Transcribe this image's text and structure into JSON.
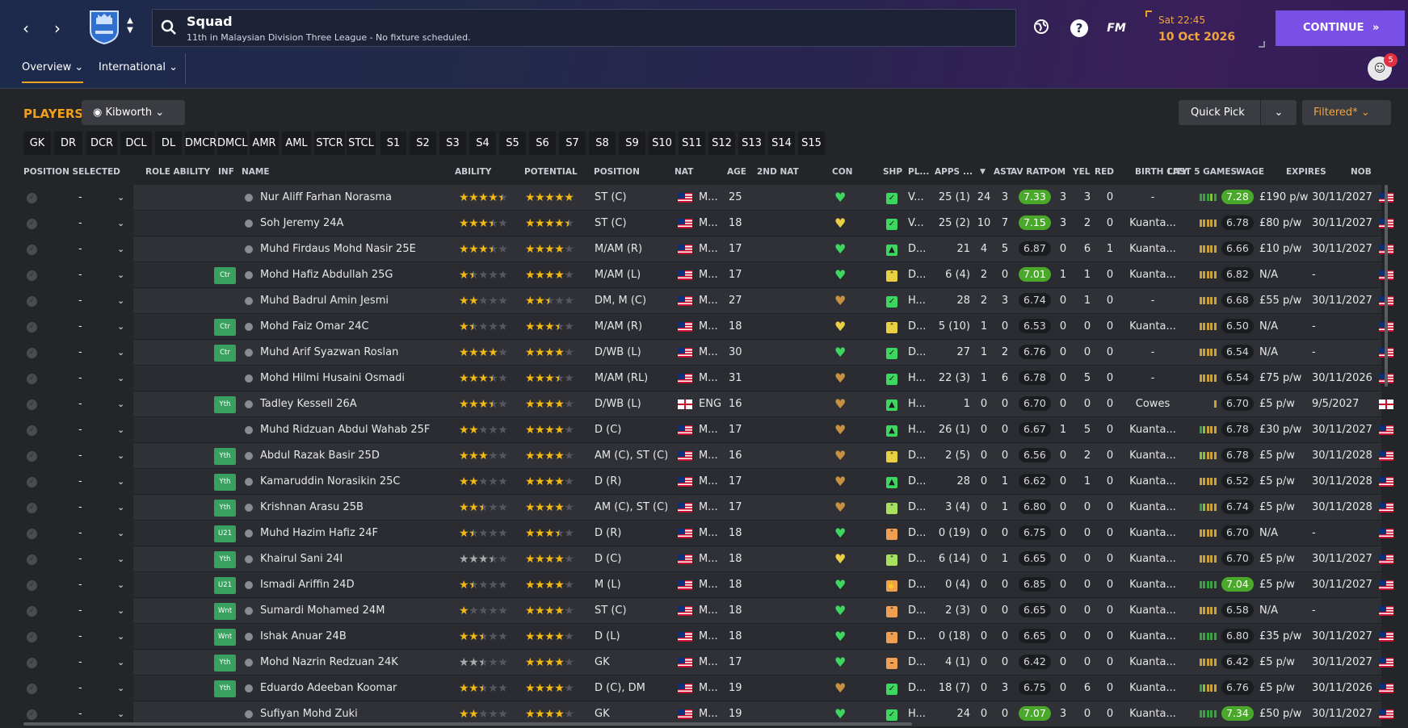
{
  "header": {
    "title": "Squad",
    "subtitle": "11th in Malaysian Division Three League - No fixture scheduled.",
    "date_time": "Sat 22:45",
    "date": "10 Oct 2026",
    "continue_label": "CONTINUE",
    "tabs": [
      "Overview",
      "International"
    ],
    "notifications": "5",
    "fm_label": "FM"
  },
  "toolbar": {
    "players_label": "PLAYERS",
    "view_label": "Kibworth",
    "quick_pick": "Quick Pick",
    "filtered": "Filtered*"
  },
  "positions": [
    "GK",
    "DR",
    "DCR",
    "DCL",
    "DL",
    "DMCR",
    "DMCL",
    "AMR",
    "AML",
    "STCR",
    "STCL",
    "S1",
    "S2",
    "S3",
    "S4",
    "S5",
    "S6",
    "S7",
    "S8",
    "S9",
    "S10",
    "S11",
    "S12",
    "S13",
    "S14",
    "S15"
  ],
  "columns": [
    "POSITION SELECTED",
    "ROLE ABILITY",
    "INF",
    "NAME",
    "ABILITY",
    "POTENTIAL",
    "POSITION",
    "NAT",
    "AGE",
    "2ND NAT",
    "CON",
    "SHP",
    "PL...",
    "APPS",
    "...",
    "AST",
    "AV RAT",
    "POM",
    "YEL",
    "RED",
    "BIRTH CITY",
    "LAST 5 GAMES",
    "WAGE",
    "EXPIRES",
    "NOB"
  ],
  "colors": {
    "accent": "#f0a020",
    "continue": "#7a4fe6",
    "rating_high": "#4aa82a",
    "star": "#f0b818"
  },
  "rows": [
    {
      "sel": "-",
      "inf": "",
      "name": "Nur Aliff Farhan Norasma",
      "ab": 4.5,
      "abc": "y",
      "pot": 5,
      "pos": "ST (C)",
      "nat": "M...",
      "flag": "my",
      "age": "25",
      "con": "green",
      "shp": "tick",
      "shpc": "#3dd65e",
      "pl": "V...",
      "apps": "25 (1)",
      "gls": "24",
      "ast": "3",
      "avr": "7.33",
      "avh": true,
      "pom": "3",
      "yel": "3",
      "red": "0",
      "city": "-",
      "last5": [
        "#3aa040",
        "#3aa040",
        "#3aa040",
        "#8ac040",
        "#3aa040"
      ],
      "l5r": "7.28",
      "l5h": true,
      "wage": "£190 p/w",
      "exp": "30/11/2027"
    },
    {
      "sel": "-",
      "inf": "",
      "name": "Soh Jeremy 24A",
      "ab": 3.5,
      "abc": "y",
      "pot": 4.5,
      "pos": "ST (C)",
      "nat": "M...",
      "flag": "my",
      "age": "18",
      "con": "yellow",
      "shp": "tick",
      "shpc": "#3dd65e",
      "pl": "V...",
      "apps": "25 (2)",
      "gls": "10",
      "ast": "7",
      "avr": "7.15",
      "avh": true,
      "pom": "3",
      "yel": "2",
      "red": "0",
      "city": "Kuanta...",
      "last5": [
        "#c8a040",
        "#c8a040",
        "#c8a040",
        "#c8a040",
        "#c8a040"
      ],
      "l5r": "6.78",
      "l5h": false,
      "wage": "£80 p/w",
      "exp": "30/11/2027"
    },
    {
      "sel": "-",
      "inf": "",
      "name": "Muhd Firdaus Mohd Nasir 25E",
      "ab": 3.5,
      "abc": "y",
      "pot": 4,
      "pos": "M/AM (R)",
      "nat": "M...",
      "flag": "my",
      "age": "17",
      "con": "green",
      "shp": "thumb",
      "shpc": "#3dd65e",
      "pl": "D...",
      "apps": "21",
      "gls": "4",
      "ast": "5",
      "avr": "6.87",
      "avh": false,
      "pom": "0",
      "yel": "6",
      "red": "1",
      "city": "Kuanta...",
      "last5": [
        "#c8a040",
        "#c8a040",
        "#c8a040",
        "#c8a040",
        "#c8a040"
      ],
      "l5r": "6.66",
      "l5h": false,
      "wage": "£10 p/w",
      "exp": "30/11/2027"
    },
    {
      "sel": "-",
      "inf": "Ctr",
      "name": "Mohd Hafiz Abdullah 25G",
      "ab": 1.5,
      "abc": "y",
      "pot": 4,
      "pos": "M/AM (L)",
      "nat": "M...",
      "flag": "my",
      "age": "17",
      "con": "green",
      "shp": "up",
      "shpc": "#e8d040",
      "pl": "D...",
      "apps": "6 (4)",
      "gls": "2",
      "ast": "0",
      "avr": "7.01",
      "avh": true,
      "pom": "1",
      "yel": "1",
      "red": "0",
      "city": "Kuanta...",
      "last5": [
        "#c8a040",
        "#c8a040",
        "#c8a040",
        "#c8a040",
        "#c8a040"
      ],
      "l5r": "6.82",
      "l5h": false,
      "wage": "N/A",
      "exp": "-"
    },
    {
      "sel": "-",
      "inf": "",
      "name": "Muhd Badrul Amin Jesmi",
      "ab": 2,
      "abc": "y",
      "pot": 2.5,
      "pos": "DM, M (C)",
      "nat": "M...",
      "flag": "my",
      "age": "27",
      "con": "brown",
      "shp": "tick",
      "shpc": "#3dd65e",
      "pl": "H...",
      "apps": "28",
      "gls": "2",
      "ast": "3",
      "avr": "6.74",
      "avh": false,
      "pom": "0",
      "yel": "1",
      "red": "0",
      "city": "-",
      "last5": [
        "#c8a040",
        "#c8a040",
        "#c8a040",
        "#c8a040",
        "#c8a040"
      ],
      "l5r": "6.68",
      "l5h": false,
      "wage": "£55 p/w",
      "exp": "30/11/2027"
    },
    {
      "sel": "-",
      "inf": "Ctr",
      "name": "Mohd Faiz Omar 24C",
      "ab": 1.5,
      "abc": "y",
      "pot": 3.5,
      "pos": "M/AM (R)",
      "nat": "M...",
      "flag": "my",
      "age": "18",
      "con": "yellow",
      "shp": "up",
      "shpc": "#e8d040",
      "pl": "D...",
      "apps": "5 (10)",
      "gls": "1",
      "ast": "0",
      "avr": "6.53",
      "avh": false,
      "pom": "0",
      "yel": "0",
      "red": "0",
      "city": "Kuanta...",
      "last5": [
        "#c8a040",
        "#c8a040",
        "#c8a040",
        "#c8a040",
        "#c8a040"
      ],
      "l5r": "6.50",
      "l5h": false,
      "wage": "N/A",
      "exp": "-"
    },
    {
      "sel": "-",
      "inf": "Ctr",
      "name": "Muhd Arif Syazwan Roslan",
      "ab": 4,
      "abc": "y",
      "pot": 4,
      "pos": "D/WB (L)",
      "nat": "M...",
      "flag": "my",
      "age": "30",
      "con": "green",
      "shp": "tick",
      "shpc": "#3dd65e",
      "pl": "D...",
      "apps": "27",
      "gls": "1",
      "ast": "2",
      "avr": "6.76",
      "avh": false,
      "pom": "0",
      "yel": "0",
      "red": "0",
      "city": "-",
      "last5": [
        "#c8a040",
        "#c8a040",
        "#c8a040",
        "#c8a040",
        "#c8a040"
      ],
      "l5r": "6.54",
      "l5h": false,
      "wage": "N/A",
      "exp": "-"
    },
    {
      "sel": "-",
      "inf": "",
      "name": "Mohd Hilmi Husaini Osmadi",
      "ab": 3.5,
      "abc": "y",
      "pot": 3.5,
      "pos": "M/AM (RL)",
      "nat": "M...",
      "flag": "my",
      "age": "31",
      "con": "brown",
      "shp": "tick",
      "shpc": "#3dd65e",
      "pl": "H...",
      "apps": "22 (3)",
      "gls": "1",
      "ast": "6",
      "avr": "6.78",
      "avh": false,
      "pom": "0",
      "yel": "5",
      "red": "0",
      "city": "-",
      "last5": [
        "#c8a040",
        "#c8a040",
        "#c8a040",
        "#c8a040",
        "#c8a040"
      ],
      "l5r": "6.54",
      "l5h": false,
      "wage": "£75 p/w",
      "exp": "30/11/2026"
    },
    {
      "sel": "-",
      "inf": "Yth",
      "name": "Tadley Kessell 26A",
      "ab": 3.5,
      "abc": "y",
      "pot": 4,
      "pos": "D/WB (L)",
      "nat": "ENG",
      "flag": "en",
      "age": "16",
      "con": "brown",
      "shp": "thumb",
      "shpc": "#3dd65e",
      "pl": "H...",
      "apps": "1",
      "gls": "0",
      "ast": "0",
      "avr": "6.70",
      "avh": false,
      "pom": "0",
      "yel": "0",
      "red": "0",
      "city": "Cowes",
      "last5": [
        "#c8a040"
      ],
      "l5r": "6.70",
      "l5h": false,
      "wage": "£5 p/w",
      "exp": "9/5/2027"
    },
    {
      "sel": "-",
      "inf": "",
      "name": "Muhd Ridzuan Abdul Wahab 25F",
      "ab": 2,
      "abc": "y",
      "pot": 4,
      "pos": "D (C)",
      "nat": "M...",
      "flag": "my",
      "age": "17",
      "con": "brown",
      "shp": "thumb",
      "shpc": "#3dd65e",
      "pl": "H...",
      "apps": "26 (1)",
      "gls": "0",
      "ast": "0",
      "avr": "6.67",
      "avh": false,
      "pom": "1",
      "yel": "5",
      "red": "0",
      "city": "Kuanta...",
      "last5": [
        "#3aa040",
        "#8ac040",
        "#c8a040",
        "#c8a040",
        "#c8a040"
      ],
      "l5r": "6.78",
      "l5h": false,
      "wage": "£30 p/w",
      "exp": "30/11/2027"
    },
    {
      "sel": "-",
      "inf": "Yth",
      "name": "Abdul Razak Basir 25D",
      "ab": 3,
      "abc": "y",
      "pot": 4,
      "pos": "AM (C), ST (C)",
      "nat": "M...",
      "flag": "my",
      "age": "16",
      "con": "brown",
      "shp": "up",
      "shpc": "#e8d040",
      "pl": "D...",
      "apps": "2 (5)",
      "gls": "0",
      "ast": "0",
      "avr": "6.56",
      "avh": false,
      "pom": "0",
      "yel": "2",
      "red": "0",
      "city": "Kuanta...",
      "last5": [
        "#8ac040",
        "#8ac040",
        "#c8a040",
        "#c8a040",
        "#c8a040"
      ],
      "l5r": "6.78",
      "l5h": false,
      "wage": "£5 p/w",
      "exp": "30/11/2028"
    },
    {
      "sel": "-",
      "inf": "Yth",
      "name": "Kamaruddin Norasikin 25C",
      "ab": 2,
      "abc": "y",
      "pot": 4,
      "pos": "D (R)",
      "nat": "M...",
      "flag": "my",
      "age": "17",
      "con": "brown",
      "shp": "thumb",
      "shpc": "#3dd65e",
      "pl": "D...",
      "apps": "28",
      "gls": "0",
      "ast": "1",
      "avr": "6.62",
      "avh": false,
      "pom": "0",
      "yel": "1",
      "red": "0",
      "city": "Kuanta...",
      "last5": [
        "#c8a040",
        "#c8a040",
        "#c8a040",
        "#c8a040",
        "#c8a040"
      ],
      "l5r": "6.52",
      "l5h": false,
      "wage": "£5 p/w",
      "exp": "30/11/2028"
    },
    {
      "sel": "-",
      "inf": "Yth",
      "name": "Krishnan Arasu 25B",
      "ab": 2.5,
      "abc": "y",
      "pot": 4,
      "pos": "AM (C), ST (C)",
      "nat": "M...",
      "flag": "my",
      "age": "17",
      "con": "brown",
      "shp": "up",
      "shpc": "#a8e060",
      "pl": "D...",
      "apps": "3 (4)",
      "gls": "0",
      "ast": "1",
      "avr": "6.80",
      "avh": false,
      "pom": "0",
      "yel": "0",
      "red": "0",
      "city": "Kuanta...",
      "last5": [
        "#3aa040",
        "#8ac040",
        "#c8a040",
        "#c8a040",
        "#c8a040"
      ],
      "l5r": "6.74",
      "l5h": false,
      "wage": "£5 p/w",
      "exp": "30/11/2028"
    },
    {
      "sel": "-",
      "inf": "U21",
      "name": "Muhd Hazim Hafiz 24F",
      "ab": 1.5,
      "abc": "y",
      "pot": 3.5,
      "pos": "D (R)",
      "nat": "M...",
      "flag": "my",
      "age": "18",
      "con": "green",
      "shp": "up",
      "shpc": "#f0a050",
      "pl": "D...",
      "apps": "0 (19)",
      "gls": "0",
      "ast": "0",
      "avr": "6.75",
      "avh": false,
      "pom": "0",
      "yel": "0",
      "red": "0",
      "city": "Kuanta...",
      "last5": [
        "#c8a040",
        "#c8a040",
        "#c8a040",
        "#c8a040",
        "#c8a040"
      ],
      "l5r": "6.70",
      "l5h": false,
      "wage": "N/A",
      "exp": "-"
    },
    {
      "sel": "-",
      "inf": "Yth",
      "name": "Khairul Sani 24I",
      "ab": 3.5,
      "abc": "g",
      "pot": 4,
      "pos": "D (C)",
      "nat": "M...",
      "flag": "my",
      "age": "18",
      "con": "yellow",
      "shp": "down",
      "shpc": "#a8e060",
      "pl": "D...",
      "apps": "6 (14)",
      "gls": "0",
      "ast": "1",
      "avr": "6.65",
      "avh": false,
      "pom": "0",
      "yel": "0",
      "red": "0",
      "city": "Kuanta...",
      "last5": [
        "#c8a040",
        "#c8a040",
        "#c8a040",
        "#c8a040",
        "#c8a040"
      ],
      "l5r": "6.70",
      "l5h": false,
      "wage": "£5 p/w",
      "exp": "30/11/2027"
    },
    {
      "sel": "-",
      "inf": "U21",
      "name": "Ismadi Ariffin 24D",
      "ab": 1.5,
      "abc": "y",
      "pot": 4,
      "pos": "M (L)",
      "nat": "M...",
      "flag": "my",
      "age": "18",
      "con": "green",
      "shp": "hand",
      "shpc": "#f0a050",
      "pl": "D...",
      "apps": "0 (4)",
      "gls": "0",
      "ast": "0",
      "avr": "6.85",
      "avh": false,
      "pom": "0",
      "yel": "0",
      "red": "0",
      "city": "Kuanta...",
      "last5": [
        "#3aa040",
        "#3aa040",
        "#3aa040",
        "#3aa040",
        "#3aa040"
      ],
      "l5r": "7.04",
      "l5h": true,
      "wage": "£5 p/w",
      "exp": "30/11/2027"
    },
    {
      "sel": "-",
      "inf": "Wnt",
      "name": "Sumardi Mohamed 24M",
      "ab": 1,
      "abc": "y",
      "pot": 4,
      "pos": "ST (C)",
      "nat": "M...",
      "flag": "my",
      "age": "18",
      "con": "green",
      "shp": "up",
      "shpc": "#f0a050",
      "pl": "D...",
      "apps": "2 (3)",
      "gls": "0",
      "ast": "0",
      "avr": "6.65",
      "avh": false,
      "pom": "0",
      "yel": "0",
      "red": "0",
      "city": "Kuanta...",
      "last5": [
        "#c8a040",
        "#c8a040",
        "#c8a040",
        "#c8a040",
        "#c8a040"
      ],
      "l5r": "6.58",
      "l5h": false,
      "wage": "N/A",
      "exp": "-"
    },
    {
      "sel": "-",
      "inf": "Wnt",
      "name": "Ishak Anuar 24B",
      "ab": 2.5,
      "abc": "y",
      "pot": 4,
      "pos": "D (L)",
      "nat": "M...",
      "flag": "my",
      "age": "18",
      "con": "green",
      "shp": "up",
      "shpc": "#f0a050",
      "pl": "D...",
      "apps": "0 (18)",
      "gls": "0",
      "ast": "0",
      "avr": "6.65",
      "avh": false,
      "pom": "0",
      "yel": "0",
      "red": "0",
      "city": "Kuanta...",
      "last5": [
        "#3aa040",
        "#3aa040",
        "#3aa040",
        "#3aa040",
        "#3aa040"
      ],
      "l5r": "6.80",
      "l5h": false,
      "wage": "£35 p/w",
      "exp": "30/11/2027"
    },
    {
      "sel": "-",
      "inf": "Yth",
      "name": "Mohd Nazrin Redzuan 24K",
      "ab": 2.5,
      "abc": "g",
      "pot": 4,
      "pos": "GK",
      "nat": "M...",
      "flag": "my",
      "age": "17",
      "con": "green",
      "shp": "minus",
      "shpc": "#f0a050",
      "pl": "D...",
      "apps": "4 (1)",
      "gls": "0",
      "ast": "0",
      "avr": "6.42",
      "avh": false,
      "pom": "0",
      "yel": "0",
      "red": "0",
      "city": "Kuanta...",
      "last5": [
        "#c8a040",
        "#c8a040",
        "#c8a040",
        "#c8a040",
        "#c8a040"
      ],
      "l5r": "6.42",
      "l5h": false,
      "wage": "£5 p/w",
      "exp": "30/11/2027"
    },
    {
      "sel": "-",
      "inf": "Yth",
      "name": "Eduardo Adeeban Koomar",
      "ab": 2.5,
      "abc": "y",
      "pot": 4,
      "pos": "D (C), DM",
      "nat": "M...",
      "flag": "my",
      "age": "19",
      "con": "brown",
      "shp": "tick",
      "shpc": "#3dd65e",
      "pl": "D...",
      "apps": "18 (7)",
      "gls": "0",
      "ast": "3",
      "avr": "6.75",
      "avh": false,
      "pom": "0",
      "yel": "6",
      "red": "0",
      "city": "Kuanta...",
      "last5": [
        "#3aa040",
        "#8ac040",
        "#c8a040",
        "#c8a040",
        "#c8a040"
      ],
      "l5r": "6.76",
      "l5h": false,
      "wage": "£5 p/w",
      "exp": "30/11/2026"
    },
    {
      "sel": "-",
      "inf": "",
      "name": "Sufiyan Mohd Zuki",
      "ab": 2,
      "abc": "y",
      "pot": 4,
      "pos": "GK",
      "nat": "M...",
      "flag": "my",
      "age": "19",
      "con": "green",
      "shp": "tick",
      "shpc": "#3dd65e",
      "pl": "H...",
      "apps": "24",
      "gls": "0",
      "ast": "0",
      "avr": "7.07",
      "avh": true,
      "pom": "3",
      "yel": "0",
      "red": "0",
      "city": "Kuanta...",
      "last5": [
        "#3aa040",
        "#3aa040",
        "#3aa040",
        "#3aa040",
        "#3aa040"
      ],
      "l5r": "7.34",
      "l5h": true,
      "wage": "£50 p/w",
      "exp": "30/11/2027"
    }
  ]
}
